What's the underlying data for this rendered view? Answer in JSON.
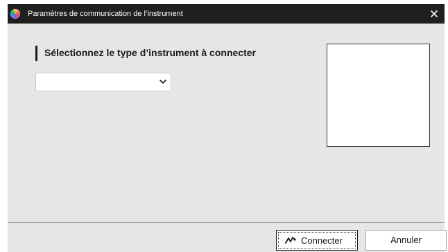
{
  "window": {
    "title": "Paramètres de communication de l’instrument",
    "app_icon": "color-wheel-icon",
    "close_icon": "close-icon"
  },
  "main": {
    "heading": "Sélectionnez le type d’instrument à connecter",
    "instrument_select": {
      "selected_value": "",
      "icon": "chevron-down-icon"
    }
  },
  "footer": {
    "connect_label": "Connecter",
    "connect_icon": "connect-pulse-icon",
    "cancel_label": "Annuler"
  },
  "colors": {
    "titlebar": "#1f1f1f",
    "dialog_background": "#e6e6e6",
    "heading_accent": "#1a1a1a"
  }
}
